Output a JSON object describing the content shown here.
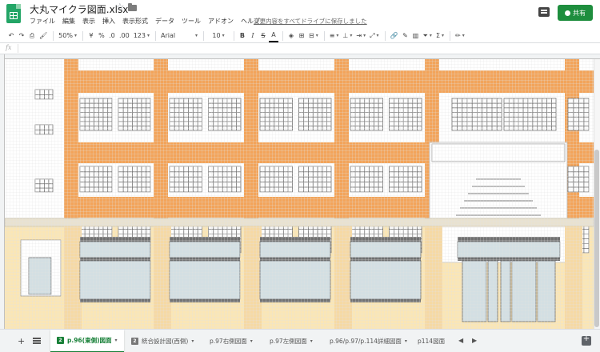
{
  "header": {
    "doc_title": "大丸マイクラ図面.xlsx",
    "menu": [
      "ファイル",
      "編集",
      "表示",
      "挿入",
      "表示形式",
      "データ",
      "ツール",
      "アドオン",
      "ヘルプ"
    ],
    "save_status": "変更内容をすべてドライブに保存しました",
    "share_label": "共有"
  },
  "toolbar": {
    "zoom": "50%",
    "currency": "¥",
    "percent": "%",
    "decimal_less": ".0",
    "decimal_more": ".00",
    "number_format": "123",
    "font": "Arial",
    "font_size": "10",
    "bold": "B",
    "italic": "I",
    "strike": "S",
    "text_color": "A"
  },
  "formula_bar": {
    "fx_label": "fx",
    "value": ""
  },
  "sheet": {
    "facade": {
      "orange": "#f3a45a",
      "cream": "#fbe6b5",
      "glass": "#d3dfe3",
      "frame": "#707070",
      "white": "#ffffff",
      "grid": "#e2e2e2"
    }
  },
  "tabs": [
    {
      "num": "2",
      "label": "p.96(東側)図面",
      "active": true
    },
    {
      "num": "2",
      "label": "統合設計図(西側)",
      "active": false
    },
    {
      "num": "",
      "label": "p.97右側図面",
      "active": false
    },
    {
      "num": "",
      "label": "p.97左側図面",
      "active": false
    },
    {
      "num": "",
      "label": "p.96/p.97/p.114詳細図面",
      "active": false
    },
    {
      "num": "",
      "label": "p114図面",
      "active": false
    }
  ]
}
